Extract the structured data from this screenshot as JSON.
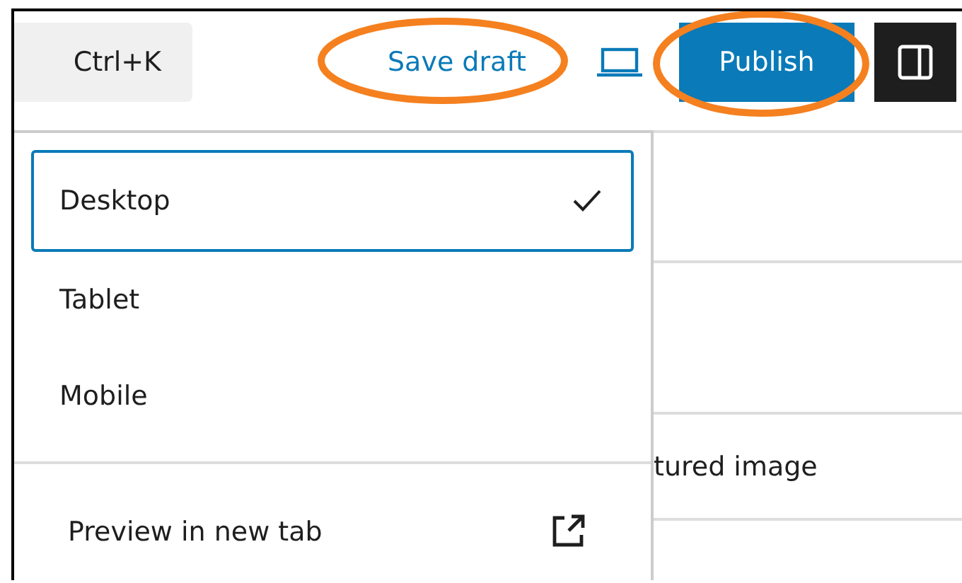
{
  "header": {
    "command_shortcut": "Ctrl+K",
    "save_draft": "Save draft",
    "publish": "Publish",
    "sidebar_toggle_on": true
  },
  "background_panel": {
    "rows": [
      "",
      "",
      "tured image"
    ]
  },
  "preview_menu": {
    "items": [
      {
        "label": "Desktop",
        "selected": true
      },
      {
        "label": "Tablet",
        "selected": false
      },
      {
        "label": "Mobile",
        "selected": false
      }
    ],
    "preview_link": "Preview in new tab"
  }
}
